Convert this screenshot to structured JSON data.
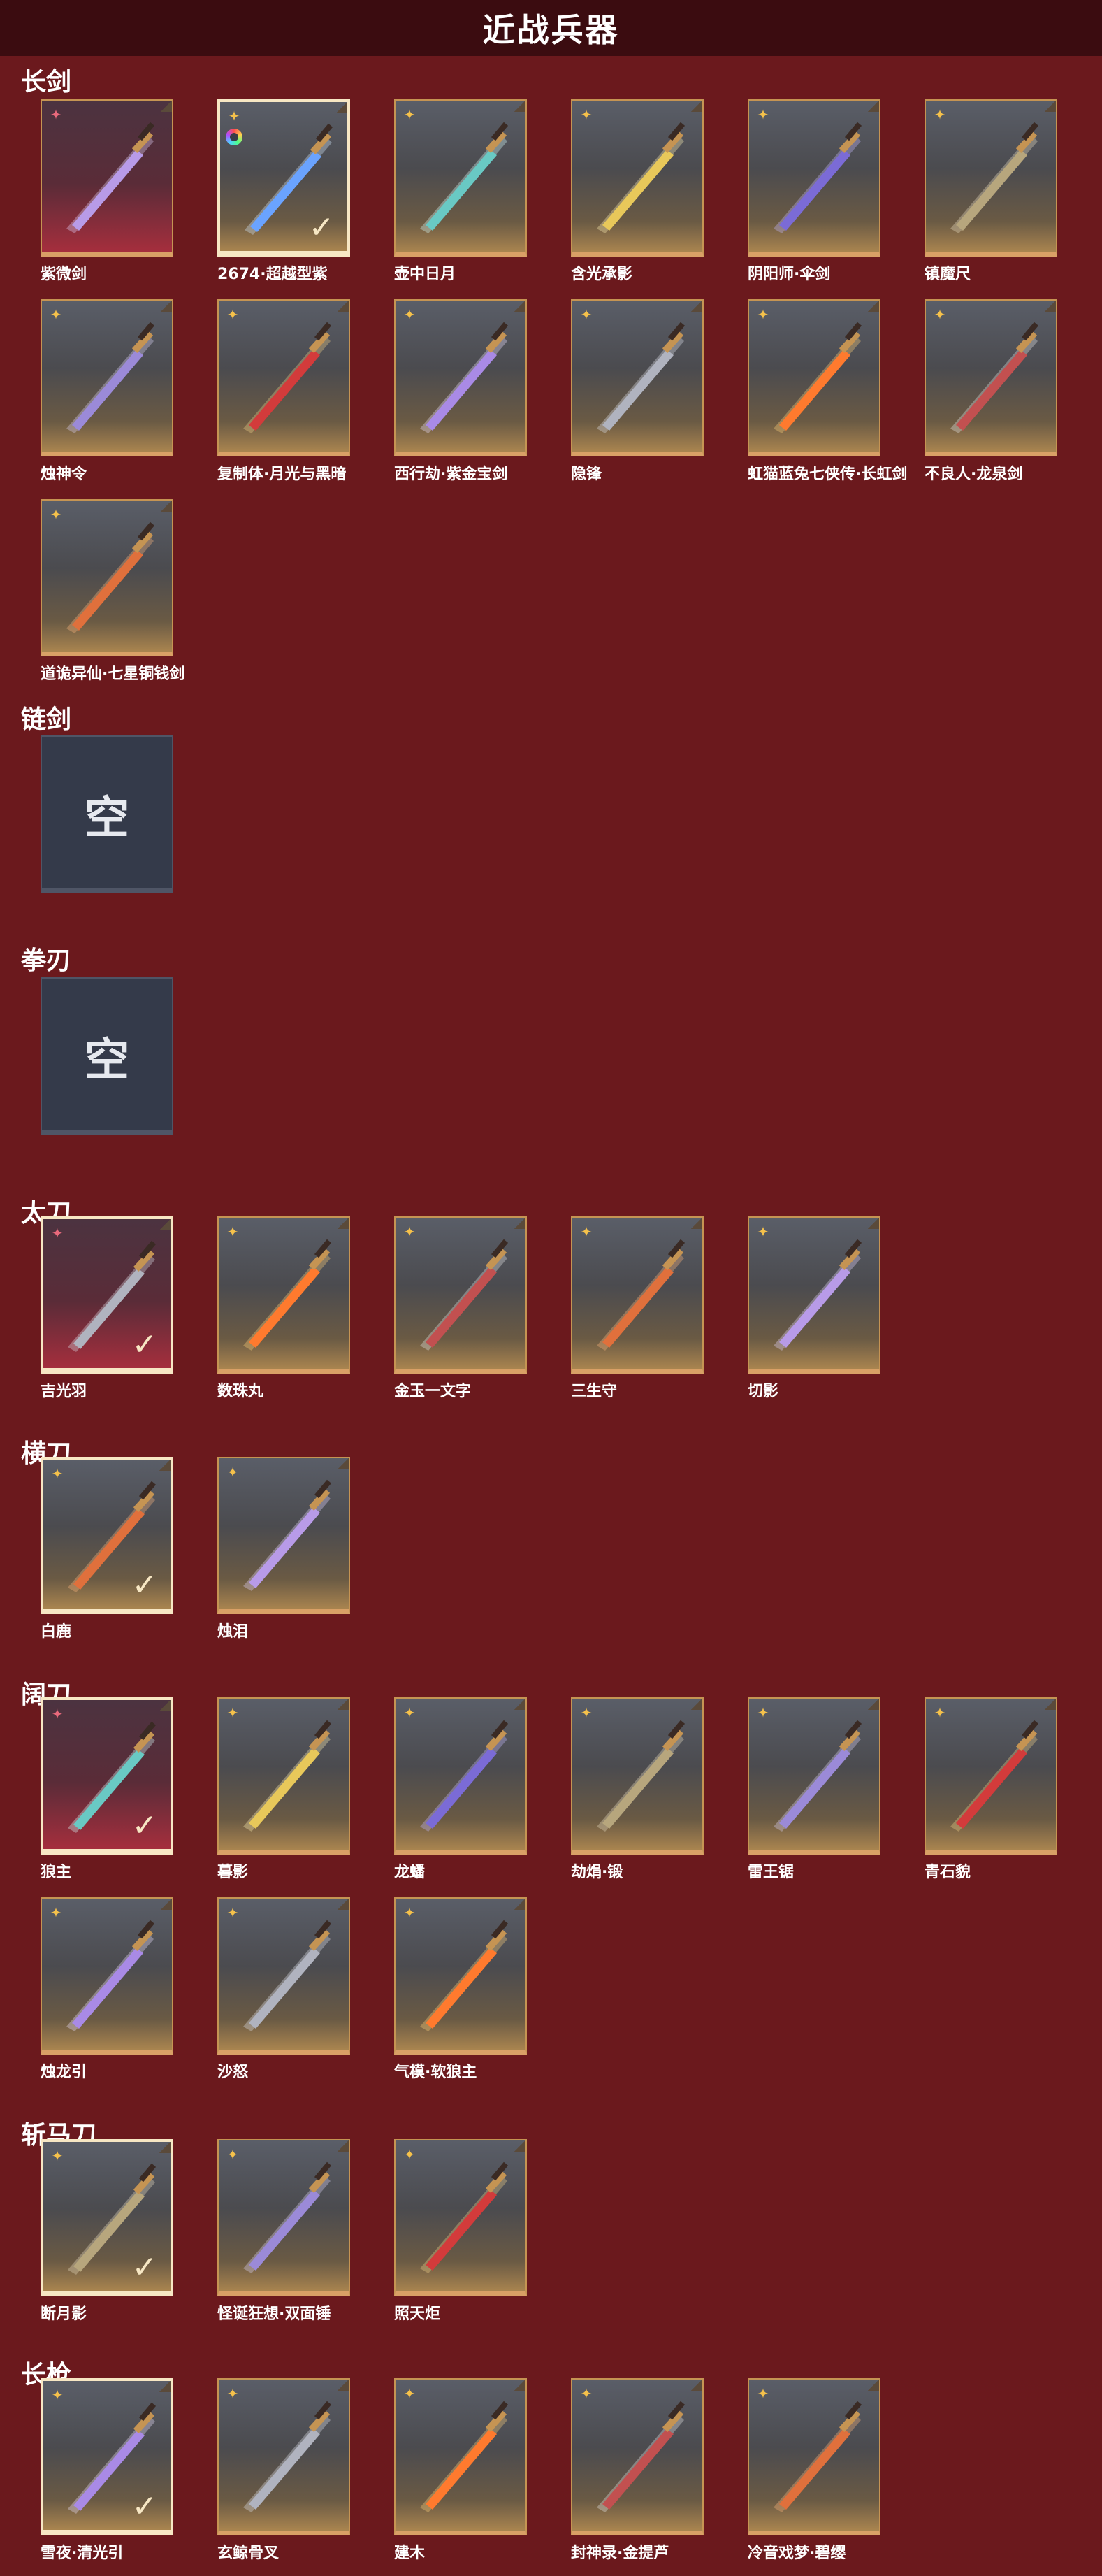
{
  "title": "近战兵器",
  "categories": [
    {
      "name": "长剑",
      "items": [
        {
          "label": "紫微剑",
          "rarity": "red",
          "equipped": false
        },
        {
          "label": "2674·超越型紫",
          "rarity": "gold",
          "equipped": true,
          "ring": true
        },
        {
          "label": "壶中日月",
          "rarity": "gold",
          "equipped": false
        },
        {
          "label": "含光承影",
          "rarity": "gold",
          "equipped": false
        },
        {
          "label": "阴阳师·伞剑",
          "rarity": "gold",
          "equipped": false
        },
        {
          "label": "镇魔尺",
          "rarity": "gold",
          "equipped": false
        },
        {
          "label": "烛神令",
          "rarity": "gold",
          "equipped": false
        },
        {
          "label": "复制体·月光与黑暗",
          "rarity": "gold",
          "equipped": false
        },
        {
          "label": "西行劫·紫金宝剑",
          "rarity": "gold",
          "equipped": false
        },
        {
          "label": "隐锋",
          "rarity": "gold",
          "equipped": false
        },
        {
          "label": "虹猫蓝兔七侠传·长虹剑",
          "rarity": "gold",
          "equipped": false
        },
        {
          "label": "不良人·龙泉剑",
          "rarity": "gold",
          "equipped": false
        },
        {
          "label": "道诡异仙·七星铜钱剑",
          "rarity": "gold",
          "equipped": false
        }
      ]
    },
    {
      "name": "链剑",
      "empty_text": "空",
      "items": []
    },
    {
      "name": "拳刃",
      "empty_text": "空",
      "items": []
    },
    {
      "name": "太刀",
      "items": [
        {
          "label": "吉光羽",
          "rarity": "red",
          "equipped": true
        },
        {
          "label": "数珠丸",
          "rarity": "gold",
          "equipped": false
        },
        {
          "label": "金玉一文字",
          "rarity": "gold",
          "equipped": false
        },
        {
          "label": "三生守",
          "rarity": "gold",
          "equipped": false
        },
        {
          "label": "切影",
          "rarity": "gold",
          "equipped": false
        }
      ]
    },
    {
      "name": "横刀",
      "items": [
        {
          "label": "白鹿",
          "rarity": "gold",
          "equipped": true
        },
        {
          "label": "烛泪",
          "rarity": "gold",
          "equipped": false
        }
      ]
    },
    {
      "name": "阔刀",
      "items": [
        {
          "label": "狼主",
          "rarity": "red",
          "equipped": true
        },
        {
          "label": "暮影",
          "rarity": "gold",
          "equipped": false
        },
        {
          "label": "龙蟠",
          "rarity": "gold",
          "equipped": false
        },
        {
          "label": "劫焆·锻",
          "rarity": "gold",
          "equipped": false
        },
        {
          "label": "雷王锯",
          "rarity": "gold",
          "equipped": false
        },
        {
          "label": "青石貌",
          "rarity": "gold",
          "equipped": false
        },
        {
          "label": "烛龙引",
          "rarity": "gold",
          "equipped": false
        },
        {
          "label": "沙怒",
          "rarity": "gold",
          "equipped": false
        },
        {
          "label": "气模·软狼主",
          "rarity": "gold",
          "equipped": false
        }
      ]
    },
    {
      "name": "斩马刀",
      "items": [
        {
          "label": "断月影",
          "rarity": "gold",
          "equipped": true
        },
        {
          "label": "怪诞狂想·双面锤",
          "rarity": "gold",
          "equipped": false
        },
        {
          "label": "照天炬",
          "rarity": "gold",
          "equipped": false
        }
      ]
    },
    {
      "name": "长枪",
      "items": [
        {
          "label": "雪夜·清光引",
          "rarity": "gold",
          "equipped": true
        },
        {
          "label": "玄鲸骨叉",
          "rarity": "gold",
          "equipped": false
        },
        {
          "label": "建木",
          "rarity": "gold",
          "equipped": false
        },
        {
          "label": "封神录·金提芦",
          "rarity": "gold",
          "equipped": false
        },
        {
          "label": "冷音戏梦·碧缨",
          "rarity": "gold",
          "equipped": false
        }
      ]
    }
  ]
}
